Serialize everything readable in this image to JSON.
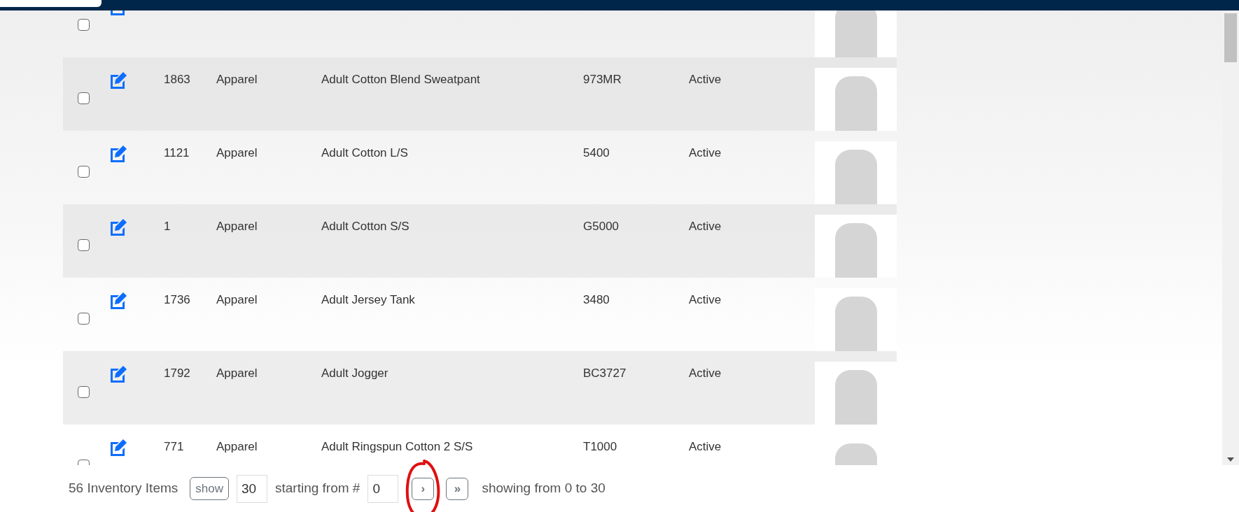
{
  "rows": [
    {
      "checked": false
    },
    {
      "checked": false,
      "id": "1863",
      "category": "Apparel",
      "name": "Adult Cotton Blend Sweatpant",
      "code": "973MR",
      "status": "Active"
    },
    {
      "checked": false,
      "id": "1121",
      "category": "Apparel",
      "name": "Adult Cotton L/S",
      "code": "5400",
      "status": "Active"
    },
    {
      "checked": false,
      "id": "1",
      "category": "Apparel",
      "name": "Adult Cotton S/S",
      "code": "G5000",
      "status": "Active"
    },
    {
      "checked": false,
      "id": "1736",
      "category": "Apparel",
      "name": "Adult Jersey Tank",
      "code": "3480",
      "status": "Active"
    },
    {
      "checked": false,
      "id": "1792",
      "category": "Apparel",
      "name": "Adult Jogger",
      "code": "BC3727",
      "status": "Active"
    },
    {
      "checked": false,
      "id": "771",
      "category": "Apparel",
      "name": "Adult Ringspun Cotton 2 S/S",
      "code": "T1000",
      "status": "Active"
    }
  ],
  "footer": {
    "count": "56 Inventory Items",
    "show_button": "show",
    "page_size": "30",
    "starting_label": "starting from #",
    "start": "0",
    "next_button": "›",
    "last_button": "»",
    "showing": "showing from 0 to 30"
  }
}
